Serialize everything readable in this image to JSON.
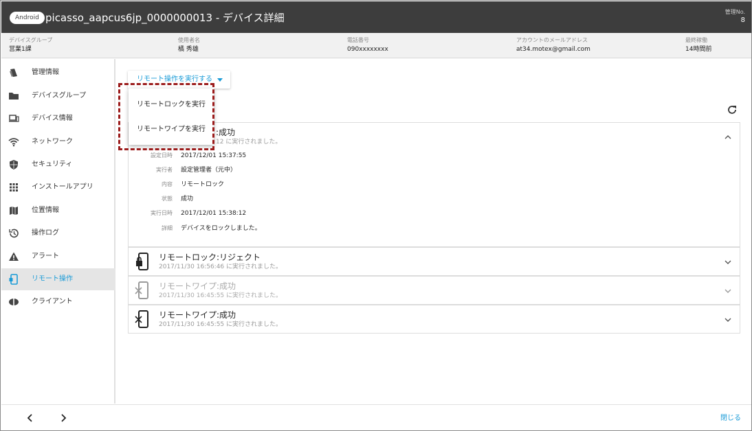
{
  "header": {
    "os_badge": "Android",
    "title": "picasso_aapcus6jp_0000000013 - デバイス詳細",
    "admin_no_label": "管理No.",
    "admin_no_value": "8"
  },
  "infobar": [
    {
      "label": "デバイスグループ",
      "value": "営業1課"
    },
    {
      "label": "使用者名",
      "value": "橘 秀雄"
    },
    {
      "label": "電話番号",
      "value": "090xxxxxxxx"
    },
    {
      "label": "アカウントのメールアドレス",
      "value": "at34.motex@gmail.com"
    },
    {
      "label": "最終稼働",
      "value": "14時間前"
    }
  ],
  "sidebar": {
    "items": [
      {
        "label": "管理情報",
        "icon": "management-icon"
      },
      {
        "label": "デバイスグループ",
        "icon": "folder-icon"
      },
      {
        "label": "デバイス情報",
        "icon": "devices-icon"
      },
      {
        "label": "ネットワーク",
        "icon": "wifi-icon"
      },
      {
        "label": "セキュリティ",
        "icon": "shield-icon"
      },
      {
        "label": "インストールアプリ",
        "icon": "apps-grid-icon"
      },
      {
        "label": "位置情報",
        "icon": "map-icon"
      },
      {
        "label": "操作ログ",
        "icon": "history-icon"
      },
      {
        "label": "アラート",
        "icon": "warning-icon"
      },
      {
        "label": "リモート操作",
        "icon": "remote-phone-icon",
        "active": true
      },
      {
        "label": "クライアント",
        "icon": "client-icon"
      }
    ]
  },
  "main": {
    "action_button": "リモート操作を実行する",
    "dropdown": {
      "items": [
        "リモートロックを実行",
        "リモートワイプを実行"
      ]
    },
    "cards": [
      {
        "title": ":成功",
        "sub": "12 に実行されました。",
        "expanded": true,
        "details": [
          {
            "key": "設定日時",
            "value": "2017/12/01 15:37:55"
          },
          {
            "key": "実行者",
            "value": "設定管理者（元中）"
          },
          {
            "key": "内容",
            "value": "リモートロック"
          },
          {
            "key": "状態",
            "value": "成功"
          },
          {
            "key": "実行日時",
            "value": "2017/12/01 15:38:12"
          },
          {
            "key": "詳細",
            "value": "デバイスをロックしました。"
          }
        ]
      },
      {
        "title": "リモートロック:リジェクト",
        "sub": "2017/11/30 16:56:46 に実行されました。",
        "icon": "lock-phone-icon"
      },
      {
        "title": "リモートワイプ:成功",
        "sub": "2017/11/30 16:45:55 に実行されました。",
        "icon": "wipe-phone-icon",
        "dim": true
      },
      {
        "title": "リモートワイプ:成功",
        "sub": "2017/11/30 16:45:55 に実行されました。",
        "icon": "wipe-phone-icon"
      }
    ]
  },
  "footer": {
    "close_label": "閉じる"
  },
  "colors": {
    "accent": "#1a9bd7",
    "header_bg": "#3d3d3d",
    "highlight": "#9b1b1b"
  }
}
